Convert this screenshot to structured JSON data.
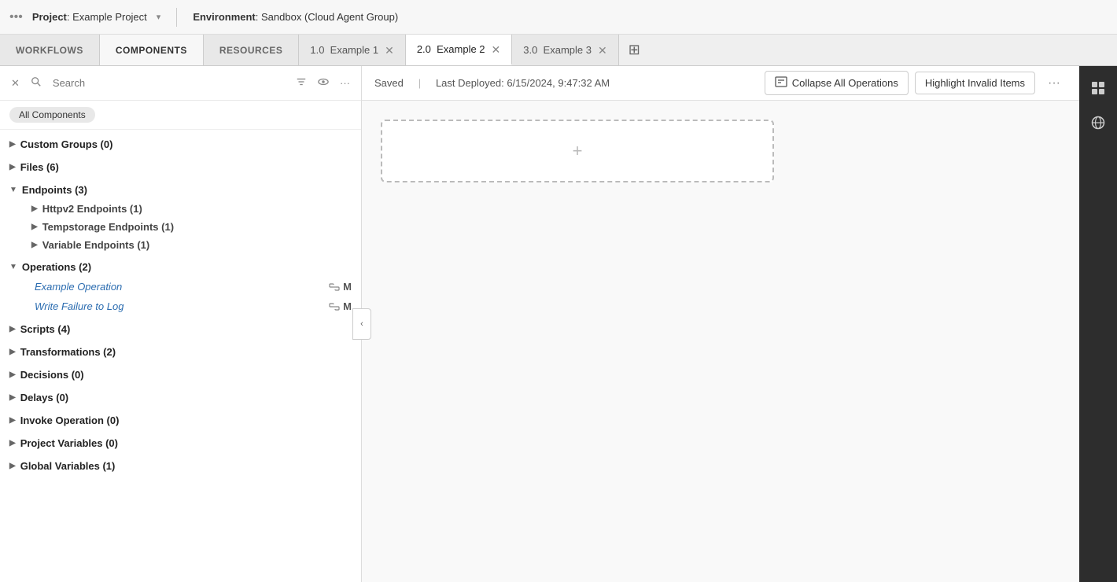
{
  "topbar": {
    "dots": "•••",
    "project_label": "Project",
    "project_name": "Example Project",
    "caret": "▾",
    "env_label": "Environment",
    "env_name": "Sandbox (Cloud Agent Group)"
  },
  "tabs": {
    "static_tabs": [
      {
        "id": "workflows",
        "label": "WORKFLOWS",
        "active": false
      },
      {
        "id": "components",
        "label": "COMPONENTS",
        "active": true
      },
      {
        "id": "resources",
        "label": "RESOURCES",
        "active": false
      }
    ],
    "dynamic_tabs": [
      {
        "id": "tab1",
        "version": "1.0",
        "name": "Example 1",
        "active": false,
        "closable": true
      },
      {
        "id": "tab2",
        "version": "2.0",
        "name": "Example 2",
        "active": true,
        "closable": true
      },
      {
        "id": "tab3",
        "version": "3.0",
        "name": "Example 3",
        "active": false,
        "closable": true
      }
    ],
    "add_tab_label": "+"
  },
  "sidebar": {
    "search_placeholder": "Search",
    "filter_label": "All Components",
    "tree": [
      {
        "id": "custom-groups",
        "label": "Custom Groups (0)",
        "expanded": false,
        "children": []
      },
      {
        "id": "files",
        "label": "Files (6)",
        "expanded": false,
        "children": []
      },
      {
        "id": "endpoints",
        "label": "Endpoints (3)",
        "expanded": true,
        "children": [
          {
            "id": "httpv2",
            "label": "Httpv2 Endpoints (1)",
            "expanded": false,
            "children": []
          },
          {
            "id": "tempstorage",
            "label": "Tempstorage Endpoints (1)",
            "expanded": false,
            "children": []
          },
          {
            "id": "variable",
            "label": "Variable Endpoints (1)",
            "expanded": false,
            "children": []
          }
        ]
      },
      {
        "id": "operations",
        "label": "Operations (2)",
        "expanded": true,
        "leaves": [
          {
            "id": "example-op",
            "label": "Example Operation"
          },
          {
            "id": "write-failure",
            "label": "Write Failure to Log"
          }
        ],
        "children": []
      },
      {
        "id": "scripts",
        "label": "Scripts (4)",
        "expanded": false,
        "children": []
      },
      {
        "id": "transformations",
        "label": "Transformations (2)",
        "expanded": false,
        "children": []
      },
      {
        "id": "decisions",
        "label": "Decisions (0)",
        "expanded": false,
        "children": []
      },
      {
        "id": "delays",
        "label": "Delays (0)",
        "expanded": false,
        "children": []
      },
      {
        "id": "invoke-operation",
        "label": "Invoke Operation (0)",
        "expanded": false,
        "children": []
      },
      {
        "id": "project-variables",
        "label": "Project Variables (0)",
        "expanded": false,
        "children": []
      },
      {
        "id": "global-variables",
        "label": "Global Variables (1)",
        "expanded": false,
        "children": []
      }
    ]
  },
  "canvas": {
    "saved_label": "Saved",
    "separator": "|",
    "last_deployed_label": "Last Deployed:",
    "last_deployed_value": "6/15/2024, 9:47:32 AM",
    "collapse_btn_label": "Collapse All Operations",
    "highlight_btn_label": "Highlight Invalid Items",
    "more_label": "···",
    "drop_zone_icon": "+"
  },
  "right_sidebar": {
    "icons": [
      {
        "id": "grid-icon",
        "symbol": "⊞"
      },
      {
        "id": "globe-icon",
        "symbol": "🌐"
      }
    ]
  }
}
